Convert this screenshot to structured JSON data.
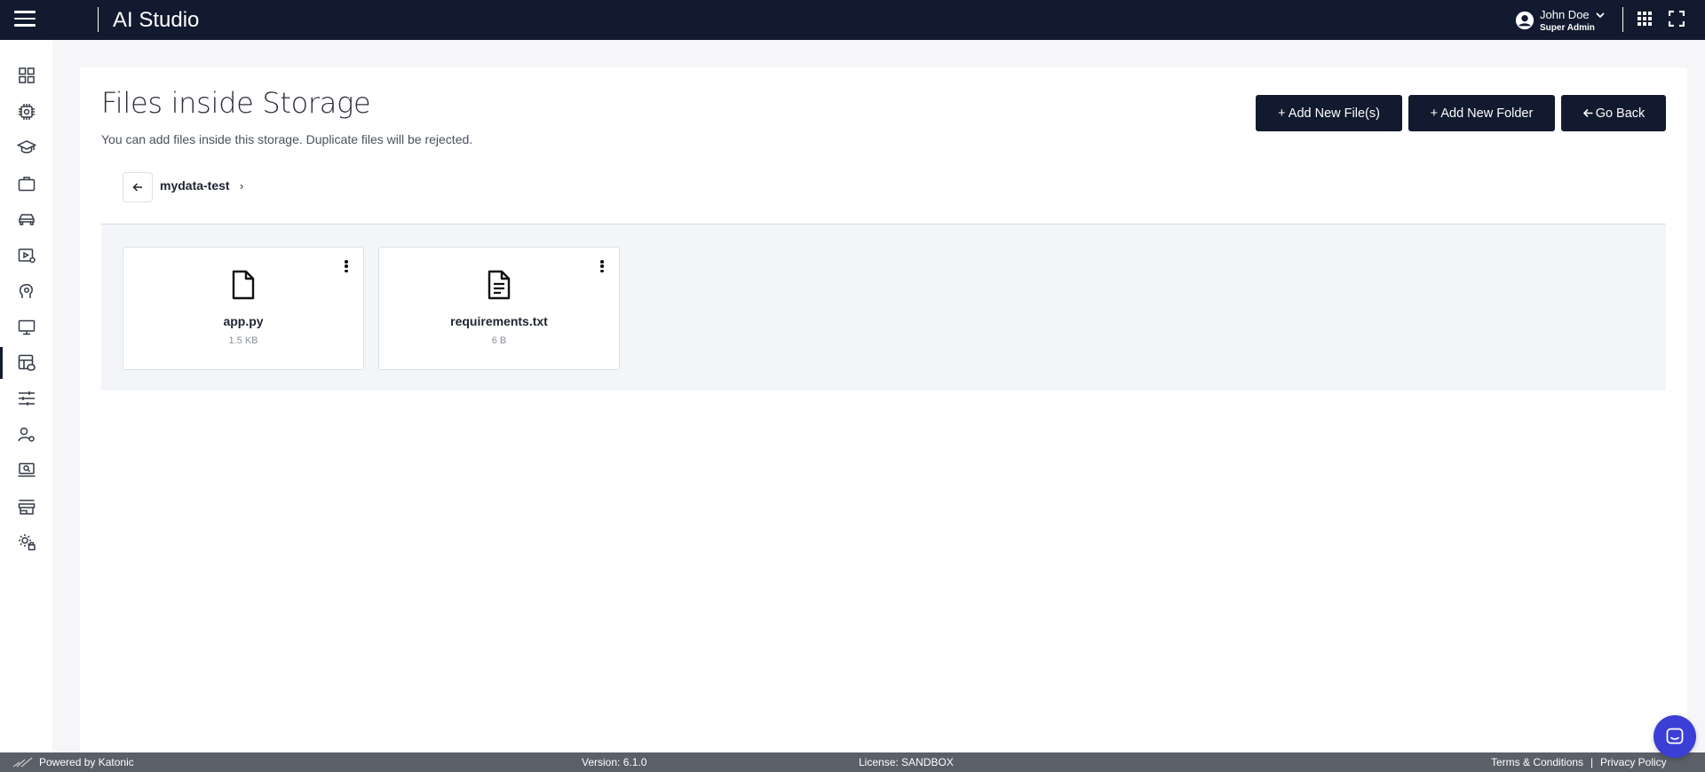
{
  "header": {
    "app_title": "AI Studio",
    "user_name": "John Doe",
    "user_role": "Super Admin"
  },
  "sidebar": {
    "items": [
      {
        "icon": "dashboard-icon"
      },
      {
        "icon": "chip-icon"
      },
      {
        "icon": "graduation-cap-icon"
      },
      {
        "icon": "briefcase-icon"
      },
      {
        "icon": "car-icon"
      },
      {
        "icon": "video-settings-icon"
      },
      {
        "icon": "brain-icon"
      },
      {
        "icon": "monitor-icon"
      },
      {
        "icon": "storage-link-icon",
        "active": true
      },
      {
        "icon": "sliders-icon"
      },
      {
        "icon": "user-settings-icon"
      },
      {
        "icon": "laptop-search-icon"
      },
      {
        "icon": "store-icon"
      },
      {
        "icon": "admin-settings-icon"
      }
    ]
  },
  "page": {
    "title": "Files inside Storage",
    "subtitle": "You can add files inside this storage. Duplicate files will be rejected.",
    "buttons": {
      "add_files": "+ Add New File(s)",
      "add_folder": "+ Add New Folder",
      "go_back": "Go Back"
    },
    "breadcrumb": {
      "current": "mydata-test",
      "separator": "›"
    },
    "files": [
      {
        "name": "app.py",
        "size": "1.5 KB",
        "icon": "file-icon"
      },
      {
        "name": "requirements.txt",
        "size": "6 B",
        "icon": "file-text-icon"
      }
    ]
  },
  "footer": {
    "powered_by": "Powered by Katonic",
    "version": "Version: 6.1.0",
    "license": "License: SANDBOX",
    "terms": "Terms & Conditions",
    "pipe": "|",
    "privacy": "Privacy Policy"
  },
  "colors": {
    "topbar": "#111a2e",
    "button": "#111a2e",
    "footer": "#5a5f68",
    "chat": "#3b3fd6"
  }
}
